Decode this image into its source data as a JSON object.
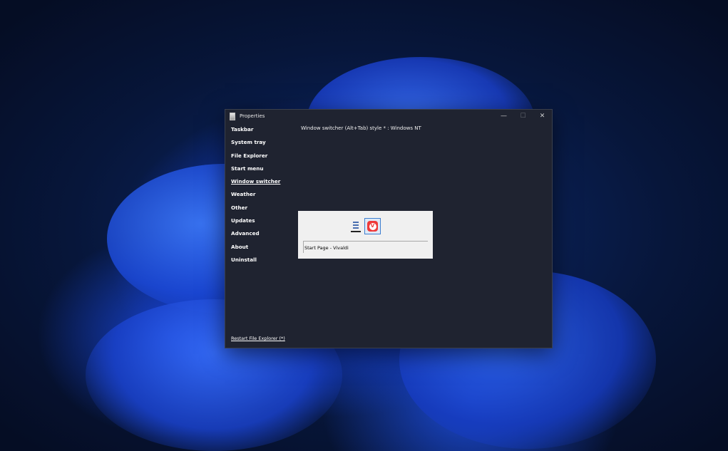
{
  "window": {
    "title": "Properties",
    "icon": "properties-app-icon",
    "controls": {
      "minimize": "—",
      "maximize": "☐",
      "close": "✕"
    }
  },
  "sidebar": {
    "items": [
      {
        "label": "Taskbar"
      },
      {
        "label": "System tray"
      },
      {
        "label": "File Explorer"
      },
      {
        "label": "Start menu"
      },
      {
        "label": "Window switcher",
        "active": true
      },
      {
        "label": "Weather"
      },
      {
        "label": "Other"
      },
      {
        "label": "Updates"
      },
      {
        "label": "Advanced"
      },
      {
        "label": "About"
      },
      {
        "label": "Uninstall"
      }
    ]
  },
  "main": {
    "setting_label": "Window switcher (Alt+Tab) style * : Windows NT",
    "preview": {
      "caption": "Start Page - Vivaldi",
      "icons": [
        "notepad-icon",
        "vivaldi-icon"
      ],
      "vivaldi_glyph": "V"
    }
  },
  "footer": {
    "restart_link": "Restart File Explorer (*)"
  },
  "colors": {
    "window_bg": "#1f2330",
    "text": "#ffffff",
    "preview_bg": "#f0f0f0",
    "selection_border": "#3e7fd0",
    "vivaldi_red": "#ef3939"
  }
}
